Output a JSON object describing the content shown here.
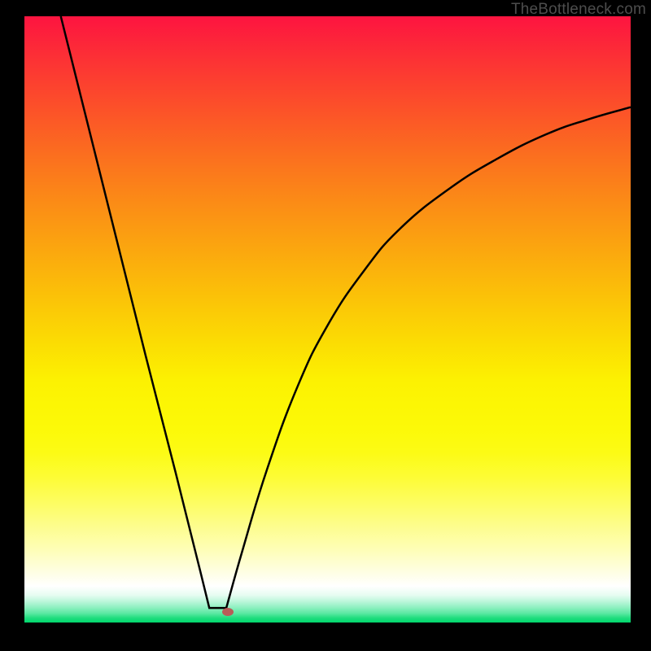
{
  "watermark": "TheBottleneck.com",
  "colors": {
    "curve": "#000000",
    "marker": "#b85c58",
    "background": "#000000"
  },
  "gradient_stops": [
    {
      "pct": 0,
      "hex": "#fd1440"
    },
    {
      "pct": 7,
      "hex": "#fc3135"
    },
    {
      "pct": 15,
      "hex": "#fc5029"
    },
    {
      "pct": 22,
      "hex": "#fb6b20"
    },
    {
      "pct": 30,
      "hex": "#fb8917"
    },
    {
      "pct": 38,
      "hex": "#fba50f"
    },
    {
      "pct": 46,
      "hex": "#fbc108"
    },
    {
      "pct": 54,
      "hex": "#fbdd03"
    },
    {
      "pct": 60,
      "hex": "#fcf102"
    },
    {
      "pct": 72,
      "hex": "#fcfb15"
    },
    {
      "pct": 80,
      "hex": "#fdfd5f"
    },
    {
      "pct": 88,
      "hex": "#fefeb7"
    },
    {
      "pct": 94,
      "hex": "#ffffff"
    },
    {
      "pct": 97,
      "hex": "#8ff0c1"
    },
    {
      "pct": 100,
      "hex": "#00d76c"
    }
  ],
  "chart_data": {
    "type": "line",
    "title": "",
    "xlabel": "",
    "ylabel": "",
    "xlim": [
      0,
      1
    ],
    "ylim": [
      0,
      1
    ],
    "description": "V-shaped bottleneck curve; steep linear left branch descending to a floor near x≈0.31, short flat floor, then curved right branch rising with diminishing slope toward top-right. Marker at the flat-to-rising transition.",
    "series": [
      {
        "name": "left_branch",
        "points": [
          {
            "x": 0.06,
            "y": 1.0
          },
          {
            "x": 0.1,
            "y": 0.84
          },
          {
            "x": 0.15,
            "y": 0.64
          },
          {
            "x": 0.2,
            "y": 0.44
          },
          {
            "x": 0.25,
            "y": 0.245
          },
          {
            "x": 0.29,
            "y": 0.085
          },
          {
            "x": 0.305,
            "y": 0.024
          }
        ]
      },
      {
        "name": "floor",
        "points": [
          {
            "x": 0.305,
            "y": 0.024
          },
          {
            "x": 0.333,
            "y": 0.024
          }
        ]
      },
      {
        "name": "right_branch",
        "points": [
          {
            "x": 0.333,
            "y": 0.024
          },
          {
            "x": 0.36,
            "y": 0.12
          },
          {
            "x": 0.4,
            "y": 0.252
          },
          {
            "x": 0.45,
            "y": 0.388
          },
          {
            "x": 0.5,
            "y": 0.49
          },
          {
            "x": 0.56,
            "y": 0.58
          },
          {
            "x": 0.62,
            "y": 0.65
          },
          {
            "x": 0.7,
            "y": 0.715
          },
          {
            "x": 0.78,
            "y": 0.765
          },
          {
            "x": 0.86,
            "y": 0.805
          },
          {
            "x": 0.93,
            "y": 0.83
          },
          {
            "x": 1.0,
            "y": 0.85
          }
        ]
      }
    ],
    "marker": {
      "x": 0.335,
      "y": 0.018
    }
  }
}
